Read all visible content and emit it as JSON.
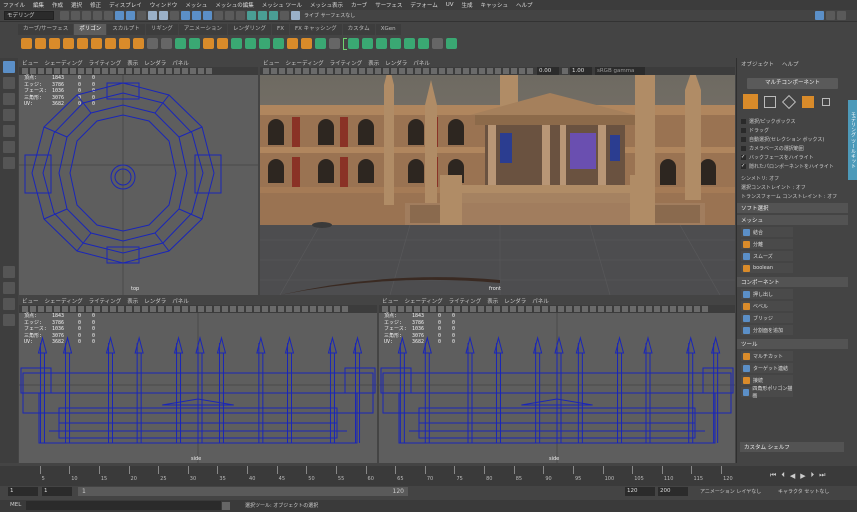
{
  "menubar": [
    "ファイル",
    "編集",
    "作成",
    "選択",
    "修正",
    "ディスプレイ",
    "ウィンドウ",
    "メッシュ",
    "メッシュの編集",
    "メッシュ ツール",
    "メッシュ表示",
    "カーブ",
    "サーフェス",
    "デフォーム",
    "UV",
    "生成",
    "キャッシュ",
    "ヘルプ"
  ],
  "status": {
    "mode": "モデリング",
    "live_label": "ライブ サーフェスなし"
  },
  "shelf_tabs": [
    "カーブ/サーフェス",
    "ポリゴン",
    "スカルプト",
    "リギング",
    "アニメーション",
    "レンダリング",
    "FX",
    "FX キャッシング",
    "カスタム",
    "XGen"
  ],
  "shelf_active": "ポリゴン",
  "viewport_menu": [
    "ビュー",
    "シェーディング",
    "ライティング",
    "表示",
    "レンダラ",
    "パネル"
  ],
  "hud_labels": [
    "頂点:",
    "エッジ:",
    "フェース:",
    "三角形:",
    "UV:"
  ],
  "hud_values": [
    "1843",
    "3786",
    "1036",
    "3076",
    "3682"
  ],
  "hud_zero": "0",
  "front_toolbar": {
    "val1": "0.00",
    "val2": "1.00",
    "colorspace": "sRGB gamma"
  },
  "viewports": {
    "top": "top",
    "front": "front",
    "side1": "side",
    "side2": "side"
  },
  "right_panel": {
    "tabs": [
      "オブジェクト",
      "ヘルプ"
    ],
    "title": "モデリング ツールキット",
    "mode_button": "マルチコンポーネント",
    "options": [
      "選択/ピックボックス",
      "ドラッグ",
      "自動選択(セレクション ボックス)",
      "カメラベースの選択範囲",
      "バックフェースをハイライト",
      "隠れたパロンポーネントをハイライト"
    ],
    "options_checked": [
      false,
      false,
      false,
      false,
      true,
      true
    ],
    "symmetry": "シンメトリ: オフ",
    "constraint1": "選択コンストレイント : オフ",
    "constraint2": "トランスフォーム コンストレイント : オフ",
    "soft_select": "ソフト選択",
    "mesh_section": "メッシュ",
    "mesh_tools": [
      "結合",
      "分離",
      "スムーズ",
      "boolean"
    ],
    "component_section": "コンポーネント",
    "component_tools": [
      "押し出し",
      "ベベル",
      "ブリッジ",
      "分割面を追加"
    ],
    "tools_section": "ツール",
    "tool_tools": [
      "マルチカット",
      "ターゲット連結",
      "接続",
      "四角形ポリゴン描画"
    ],
    "custom_shelf": "カスタム シェルフ",
    "side_tab": "モデリング ツールキット"
  },
  "timeline_ticks": [
    "5",
    "10",
    "15",
    "20",
    "25",
    "30",
    "35",
    "40",
    "45",
    "50",
    "55",
    "60",
    "65",
    "70",
    "75",
    "80",
    "85",
    "90",
    "95",
    "100",
    "105",
    "110",
    "115",
    "120"
  ],
  "range": {
    "start": "1",
    "current": "1",
    "slider_start": "1",
    "slider_end": "120",
    "end": "120",
    "max": "200",
    "anim_layer": "アニメーション レイヤなし",
    "char_set": "キャラクタ セットなし"
  },
  "mel": {
    "label": "MEL",
    "status": "選択ツール: オブジェクトの選択"
  },
  "colors": {
    "accent": "#5b8fc7",
    "orange": "#d98b2a",
    "wire": "#1a26b8",
    "viewport_bg": "#5e5e5e"
  }
}
